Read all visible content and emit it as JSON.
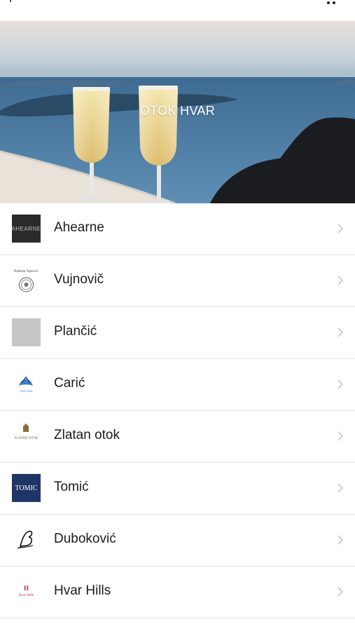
{
  "header": {
    "title": "OTOK HVAR"
  },
  "wineries": [
    {
      "label": "Ahearne",
      "logo_text": "AHEARNE"
    },
    {
      "label": "Vujnovič",
      "logo_text": "Podrum Vujnović"
    },
    {
      "label": "Plančić"
    },
    {
      "label": "Carić",
      "logo_text": "Vina Carić"
    },
    {
      "label": "Zlatan otok",
      "logo_text": "ZLATAN OTOK"
    },
    {
      "label": "Tomić",
      "logo_text": "TOMIC"
    },
    {
      "label": "Duboković"
    },
    {
      "label": "Hvar Hills",
      "logo_text": "Hvar Hills"
    }
  ],
  "icons": {
    "more": "more-dots-icon",
    "chevron": "chevron-right-icon"
  },
  "colors": {
    "separator": "#e3e3e6",
    "chevron": "#c7c7cc",
    "tomic_logo_bg": "#1f3566",
    "ahearne_logo_bg": "#2b2b2b",
    "plancic_logo_bg": "#c6c6c6",
    "hvar_hills_red": "#c0272d"
  }
}
